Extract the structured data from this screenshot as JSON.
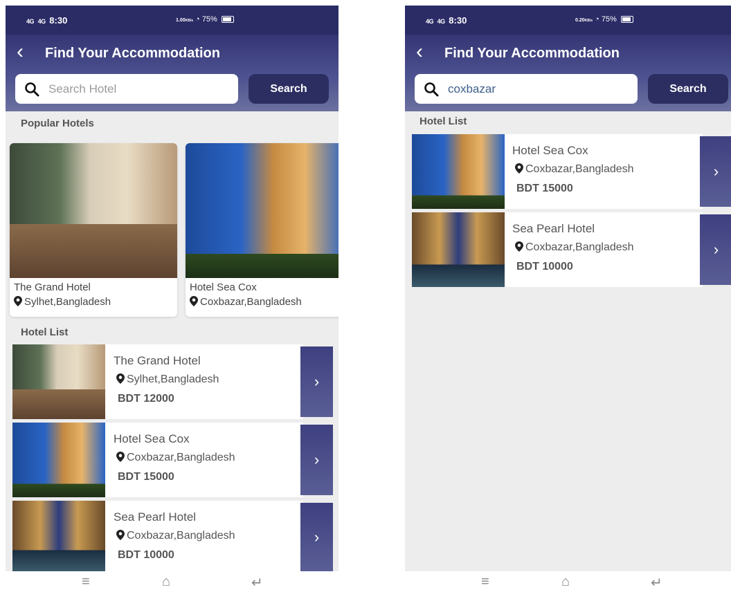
{
  "status": {
    "signal": "4G",
    "time": "8:30",
    "battery": "75%",
    "left_speed": "1.00",
    "right_speed": "0.20",
    "speed_unit": "KB/s"
  },
  "left_screen": {
    "title": "Find Your Accommodation",
    "search": {
      "placeholder": "Search Hotel",
      "button": "Search"
    },
    "popular_title": "Popular Hotels",
    "popular": [
      {
        "name": "The Grand Hotel",
        "location": "Sylhet,Bangladesh"
      },
      {
        "name": "Hotel Sea Cox",
        "location": "Coxbazar,Bangladesh"
      }
    ],
    "list_title": "Hotel List",
    "list": [
      {
        "name": "The Grand Hotel",
        "location": "Sylhet,Bangladesh",
        "price": "BDT 12000"
      },
      {
        "name": "Hotel Sea Cox",
        "location": "Coxbazar,Bangladesh",
        "price": "BDT 15000"
      },
      {
        "name": "Sea Pearl Hotel",
        "location": "Coxbazar,Bangladesh",
        "price": "BDT 10000"
      }
    ]
  },
  "right_screen": {
    "title": "Find Your Accommodation",
    "search": {
      "value": "coxbazar",
      "button": "Search"
    },
    "list_title": "Hotel List",
    "list": [
      {
        "name": "Hotel Sea Cox",
        "location": "Coxbazar,Bangladesh",
        "price": "BDT 15000"
      },
      {
        "name": "Sea Pearl Hotel",
        "location": "Coxbazar,Bangladesh",
        "price": "BDT 10000"
      }
    ]
  },
  "icons": {
    "back": "chevron-left-icon",
    "search": "search-icon",
    "location": "map-pin-icon",
    "arrow": "chevron-right-icon",
    "nav": [
      "menu-icon",
      "home-icon",
      "back-nav-icon"
    ]
  },
  "colors": {
    "header": "#353574",
    "button": "#2c2e62",
    "background": "#ededed"
  }
}
